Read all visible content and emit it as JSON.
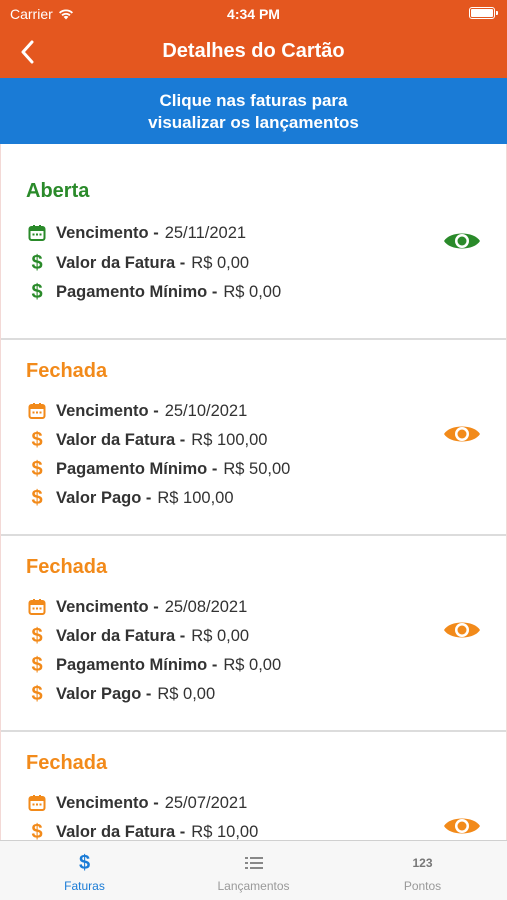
{
  "status_bar": {
    "carrier": "Carrier",
    "time": "4:34 PM"
  },
  "nav": {
    "title": "Detalhes do Cartão"
  },
  "banner": {
    "line1": "Clique nas faturas para",
    "line2": "visualizar os lançamentos"
  },
  "colors": {
    "header": "#e4571f",
    "banner": "#1a7bd6",
    "open": "#2a8a2a",
    "closed": "#f28a1a",
    "active_tab": "#1a7bd6"
  },
  "invoices": [
    {
      "status": "Aberta",
      "rows": [
        {
          "icon": "calendar-icon",
          "label": "Vencimento -",
          "value": "25/11/2021"
        },
        {
          "icon": "dollar-icon",
          "label": "Valor da Fatura -",
          "value": "R$ 0,00"
        },
        {
          "icon": "dollar-icon",
          "label": "Pagamento Mínimo -",
          "value": "R$ 0,00"
        }
      ]
    },
    {
      "status": "Fechada",
      "rows": [
        {
          "icon": "calendar-icon",
          "label": "Vencimento -",
          "value": "25/10/2021"
        },
        {
          "icon": "dollar-icon",
          "label": "Valor da Fatura -",
          "value": "R$ 100,00"
        },
        {
          "icon": "dollar-icon",
          "label": "Pagamento Mínimo -",
          "value": "R$ 50,00"
        },
        {
          "icon": "dollar-icon",
          "label": "Valor Pago -",
          "value": "R$ 100,00"
        }
      ]
    },
    {
      "status": "Fechada",
      "rows": [
        {
          "icon": "calendar-icon",
          "label": "Vencimento -",
          "value": "25/08/2021"
        },
        {
          "icon": "dollar-icon",
          "label": "Valor da Fatura -",
          "value": "R$ 0,00"
        },
        {
          "icon": "dollar-icon",
          "label": "Pagamento Mínimo -",
          "value": "R$ 0,00"
        },
        {
          "icon": "dollar-icon",
          "label": "Valor Pago -",
          "value": "R$ 0,00"
        }
      ]
    },
    {
      "status": "Fechada",
      "rows": [
        {
          "icon": "calendar-icon",
          "label": "Vencimento -",
          "value": "25/07/2021"
        },
        {
          "icon": "dollar-icon",
          "label": "Valor da Fatura -",
          "value": "R$ 10,00"
        }
      ]
    }
  ],
  "tabs": [
    {
      "label": "Faturas",
      "icon": "dollar-icon",
      "active": true
    },
    {
      "label": "Lançamentos",
      "icon": "list-icon",
      "active": false
    },
    {
      "label": "Pontos",
      "icon": "numbers-icon",
      "icon_text": "123",
      "active": false
    }
  ]
}
